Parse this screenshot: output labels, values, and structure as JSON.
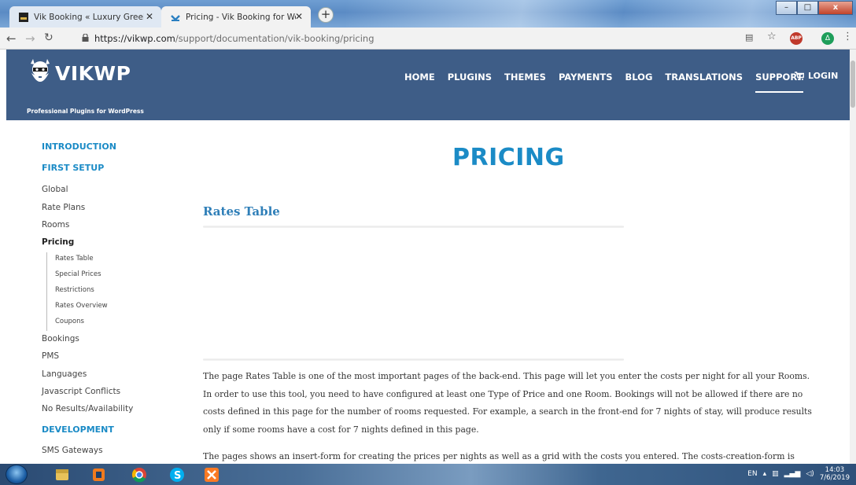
{
  "browser": {
    "tabs": [
      {
        "title": "Vik Booking « Luxury Greek Hotel",
        "active": false
      },
      {
        "title": "Pricing - Vik Booking for WordPress",
        "active": true
      }
    ],
    "new_tab_label": "+",
    "url_host": "https://vikwp.com",
    "url_path": "/support/documentation/vik-booking/pricing",
    "window_buttons": {
      "minimize": "–",
      "maximize": "□",
      "close": "x"
    },
    "extensions": {
      "abp": "ABP",
      "green": "Δ"
    }
  },
  "site": {
    "brand": "VikWP",
    "tagline": "Professional Plugins for WordPress",
    "nav": [
      "HOME",
      "PLUGINS",
      "THEMES",
      "PAYMENTS",
      "BLOG",
      "TRANSLATIONS",
      "SUPPORT"
    ],
    "nav_active": "SUPPORT",
    "login": "LOGIN",
    "header_color": "#3e5d87",
    "accent_color": "#1b8bc6"
  },
  "sidebar": {
    "sections": [
      {
        "kind": "head",
        "label": "INTRODUCTION"
      },
      {
        "kind": "head",
        "label": "FIRST SETUP"
      },
      {
        "kind": "item",
        "label": "Global"
      },
      {
        "kind": "item",
        "label": "Rate Plans"
      },
      {
        "kind": "item",
        "label": "Rooms"
      },
      {
        "kind": "item-bold",
        "label": "Pricing"
      },
      {
        "kind": "sub",
        "label": "Rates Table"
      },
      {
        "kind": "sub",
        "label": "Special Prices"
      },
      {
        "kind": "sub",
        "label": "Restrictions"
      },
      {
        "kind": "sub",
        "label": "Rates Overview"
      },
      {
        "kind": "sub",
        "label": "Coupons"
      },
      {
        "kind": "item",
        "label": "Bookings"
      },
      {
        "kind": "item",
        "label": "PMS"
      },
      {
        "kind": "item",
        "label": "Languages"
      },
      {
        "kind": "item",
        "label": "Javascript Conflicts"
      },
      {
        "kind": "item",
        "label": "No Results/Availability"
      },
      {
        "kind": "head",
        "label": "DEVELOPMENT"
      },
      {
        "kind": "item",
        "label": "SMS Gateways"
      }
    ]
  },
  "main": {
    "page_title": "PRICING",
    "section_title": "Rates Table",
    "paragraph1": [
      "The page Rates Table is one of the most important pages of the back-end. This page will let you enter the costs per night for all your Rooms.",
      "In order to use this tool, you need to have configured at least one Type of Price and one Room. Bookings will not be allowed if there are no",
      "costs defined in this page for the number of rooms requested. For example, a search in the front-end for 7 nights of stay, will produce results",
      "only if some rooms have a cost for 7 nights defined in this page."
    ],
    "paragraph2": [
      "The pages shows an insert-form for creating the prices per nights as well as a grid with the costs you entered. The costs-creation-form is"
    ]
  },
  "taskbar": {
    "language": "EN",
    "time": "14:03",
    "date": "7/6/2019"
  }
}
